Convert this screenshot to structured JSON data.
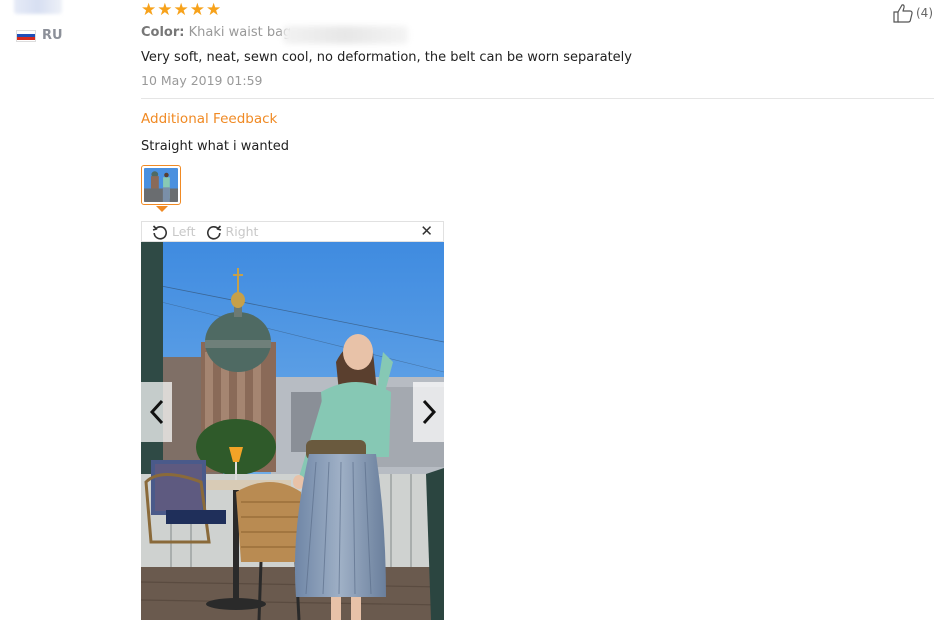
{
  "user": {
    "country_code": "RU",
    "flag_icon": "russia-flag-icon"
  },
  "review": {
    "rating": 5,
    "stars_text": "★★★★★",
    "color_label": "Color:",
    "color_value": "Khaki waist bag",
    "text": "Very soft, neat, sewn cool, no deformation, the belt can be worn separately",
    "date": "10 May 2019 01:59",
    "likes": "(4)"
  },
  "additional": {
    "title": "Additional Feedback",
    "text": "Straight what i wanted"
  },
  "viewer": {
    "rotate_left_label": "Left",
    "rotate_right_label": "Right",
    "close_glyph": "✕"
  },
  "colors": {
    "star": "#f7a21b",
    "accent": "#f08a24",
    "muted_text": "#999999"
  }
}
